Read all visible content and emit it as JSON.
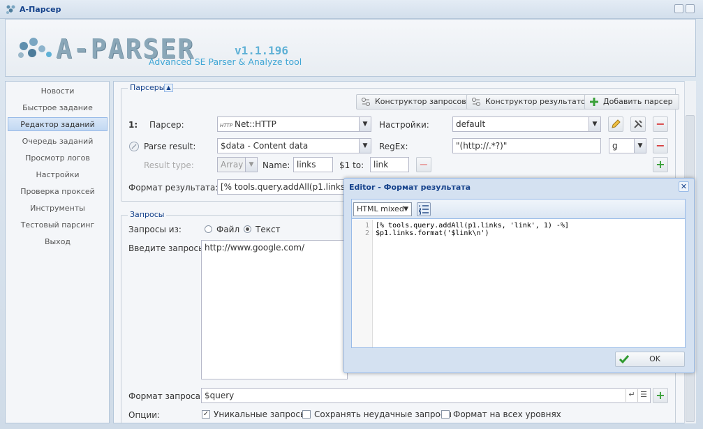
{
  "window": {
    "title": "A-Парсер"
  },
  "header": {
    "logo_text": "A-PARSER",
    "version": "v1.1.196",
    "tagline": "Advanced SE Parser & Analyze tool"
  },
  "sidebar": {
    "items": [
      {
        "label": "Новости"
      },
      {
        "label": "Быстрое задание"
      },
      {
        "label": "Редактор заданий",
        "active": true
      },
      {
        "label": "Очередь заданий"
      },
      {
        "label": "Просмотр логов"
      },
      {
        "label": "Настройки"
      },
      {
        "label": "Проверка проксей"
      },
      {
        "label": "Инструменты"
      },
      {
        "label": "Тестовый парсинг"
      },
      {
        "label": "Выход"
      }
    ]
  },
  "parsers": {
    "legend": "Парсеры",
    "buttons": {
      "query_builder": "Конструктор запросов",
      "result_builder": "Конструктор результатов",
      "add_parser": "Добавить парсер"
    },
    "row1": {
      "index": "1:",
      "parser_label": "Парсер:",
      "parser_value": "Net::HTTP",
      "settings_label": "Настройки:",
      "settings_value": "default"
    },
    "row2": {
      "parse_result_label": "Parse result:",
      "parse_result_value": "$data - Content data",
      "regex_label": "RegEx:",
      "regex_value": "\"(http://.*?)\"",
      "regex_flag": "g"
    },
    "row3": {
      "result_type_label": "Result type:",
      "result_type_value": "Array",
      "name_label": "Name:",
      "name_value": "links",
      "to_label": "$1 to:",
      "to_value": "link"
    },
    "format": {
      "label": "Формат результата:",
      "value": "[% tools.query.addAll(p1.links, 'link', 1) -%]"
    }
  },
  "queries": {
    "legend": "Запросы",
    "from_label": "Запросы из:",
    "opt_file": "Файл",
    "opt_text": "Текст",
    "selected": "Текст",
    "enter_label": "Введите запросы:",
    "value": "http://www.google.com/",
    "format_label": "Формат запроса:",
    "format_value": "$query",
    "options_label": "Опции:",
    "options": [
      {
        "label": "Уникальные запросы",
        "checked": true
      },
      {
        "label": "Сохранять неудачные запросы",
        "checked": false
      },
      {
        "label": "Формат на всех уровнях",
        "checked": false
      }
    ]
  },
  "editor": {
    "title": "Editor - Формат результата",
    "mode": "HTML mixed",
    "lines": [
      {
        "num": "1",
        "text": "[% tools.query.addAll(p1.links, 'link', 1) -%]"
      },
      {
        "num": "2",
        "text": "$p1.links.format('$link\\n')"
      }
    ],
    "ok_label": "OK"
  }
}
